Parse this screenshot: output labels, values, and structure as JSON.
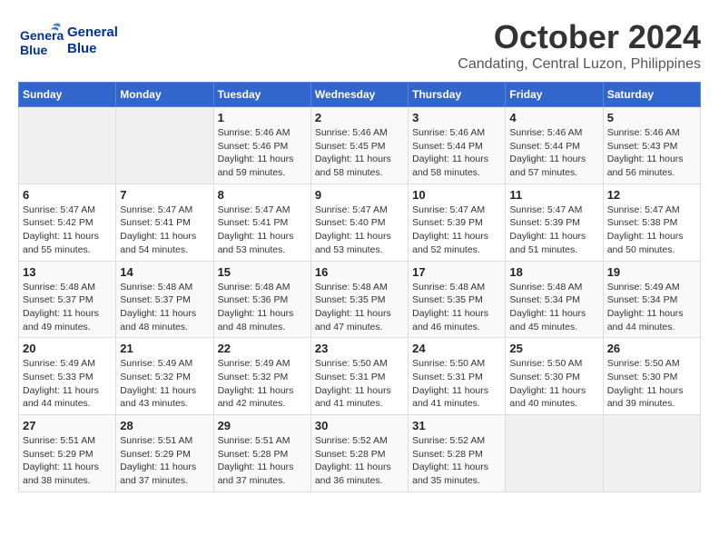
{
  "header": {
    "logo_line1": "General",
    "logo_line2": "Blue",
    "month_year": "October 2024",
    "location": "Candating, Central Luzon, Philippines"
  },
  "weekdays": [
    "Sunday",
    "Monday",
    "Tuesday",
    "Wednesday",
    "Thursday",
    "Friday",
    "Saturday"
  ],
  "weeks": [
    [
      {
        "day": null,
        "sunrise": null,
        "sunset": null,
        "daylight": null
      },
      {
        "day": null,
        "sunrise": null,
        "sunset": null,
        "daylight": null
      },
      {
        "day": 1,
        "sunrise": "5:46 AM",
        "sunset": "5:46 PM",
        "daylight": "11 hours and 59 minutes."
      },
      {
        "day": 2,
        "sunrise": "5:46 AM",
        "sunset": "5:45 PM",
        "daylight": "11 hours and 58 minutes."
      },
      {
        "day": 3,
        "sunrise": "5:46 AM",
        "sunset": "5:44 PM",
        "daylight": "11 hours and 58 minutes."
      },
      {
        "day": 4,
        "sunrise": "5:46 AM",
        "sunset": "5:44 PM",
        "daylight": "11 hours and 57 minutes."
      },
      {
        "day": 5,
        "sunrise": "5:46 AM",
        "sunset": "5:43 PM",
        "daylight": "11 hours and 56 minutes."
      }
    ],
    [
      {
        "day": 6,
        "sunrise": "5:47 AM",
        "sunset": "5:42 PM",
        "daylight": "11 hours and 55 minutes."
      },
      {
        "day": 7,
        "sunrise": "5:47 AM",
        "sunset": "5:41 PM",
        "daylight": "11 hours and 54 minutes."
      },
      {
        "day": 8,
        "sunrise": "5:47 AM",
        "sunset": "5:41 PM",
        "daylight": "11 hours and 53 minutes."
      },
      {
        "day": 9,
        "sunrise": "5:47 AM",
        "sunset": "5:40 PM",
        "daylight": "11 hours and 53 minutes."
      },
      {
        "day": 10,
        "sunrise": "5:47 AM",
        "sunset": "5:39 PM",
        "daylight": "11 hours and 52 minutes."
      },
      {
        "day": 11,
        "sunrise": "5:47 AM",
        "sunset": "5:39 PM",
        "daylight": "11 hours and 51 minutes."
      },
      {
        "day": 12,
        "sunrise": "5:47 AM",
        "sunset": "5:38 PM",
        "daylight": "11 hours and 50 minutes."
      }
    ],
    [
      {
        "day": 13,
        "sunrise": "5:48 AM",
        "sunset": "5:37 PM",
        "daylight": "11 hours and 49 minutes."
      },
      {
        "day": 14,
        "sunrise": "5:48 AM",
        "sunset": "5:37 PM",
        "daylight": "11 hours and 48 minutes."
      },
      {
        "day": 15,
        "sunrise": "5:48 AM",
        "sunset": "5:36 PM",
        "daylight": "11 hours and 48 minutes."
      },
      {
        "day": 16,
        "sunrise": "5:48 AM",
        "sunset": "5:35 PM",
        "daylight": "11 hours and 47 minutes."
      },
      {
        "day": 17,
        "sunrise": "5:48 AM",
        "sunset": "5:35 PM",
        "daylight": "11 hours and 46 minutes."
      },
      {
        "day": 18,
        "sunrise": "5:48 AM",
        "sunset": "5:34 PM",
        "daylight": "11 hours and 45 minutes."
      },
      {
        "day": 19,
        "sunrise": "5:49 AM",
        "sunset": "5:34 PM",
        "daylight": "11 hours and 44 minutes."
      }
    ],
    [
      {
        "day": 20,
        "sunrise": "5:49 AM",
        "sunset": "5:33 PM",
        "daylight": "11 hours and 44 minutes."
      },
      {
        "day": 21,
        "sunrise": "5:49 AM",
        "sunset": "5:32 PM",
        "daylight": "11 hours and 43 minutes."
      },
      {
        "day": 22,
        "sunrise": "5:49 AM",
        "sunset": "5:32 PM",
        "daylight": "11 hours and 42 minutes."
      },
      {
        "day": 23,
        "sunrise": "5:50 AM",
        "sunset": "5:31 PM",
        "daylight": "11 hours and 41 minutes."
      },
      {
        "day": 24,
        "sunrise": "5:50 AM",
        "sunset": "5:31 PM",
        "daylight": "11 hours and 41 minutes."
      },
      {
        "day": 25,
        "sunrise": "5:50 AM",
        "sunset": "5:30 PM",
        "daylight": "11 hours and 40 minutes."
      },
      {
        "day": 26,
        "sunrise": "5:50 AM",
        "sunset": "5:30 PM",
        "daylight": "11 hours and 39 minutes."
      }
    ],
    [
      {
        "day": 27,
        "sunrise": "5:51 AM",
        "sunset": "5:29 PM",
        "daylight": "11 hours and 38 minutes."
      },
      {
        "day": 28,
        "sunrise": "5:51 AM",
        "sunset": "5:29 PM",
        "daylight": "11 hours and 37 minutes."
      },
      {
        "day": 29,
        "sunrise": "5:51 AM",
        "sunset": "5:28 PM",
        "daylight": "11 hours and 37 minutes."
      },
      {
        "day": 30,
        "sunrise": "5:52 AM",
        "sunset": "5:28 PM",
        "daylight": "11 hours and 36 minutes."
      },
      {
        "day": 31,
        "sunrise": "5:52 AM",
        "sunset": "5:28 PM",
        "daylight": "11 hours and 35 minutes."
      },
      {
        "day": null,
        "sunrise": null,
        "sunset": null,
        "daylight": null
      },
      {
        "day": null,
        "sunrise": null,
        "sunset": null,
        "daylight": null
      }
    ]
  ],
  "labels": {
    "sunrise": "Sunrise:",
    "sunset": "Sunset:",
    "daylight": "Daylight:"
  }
}
